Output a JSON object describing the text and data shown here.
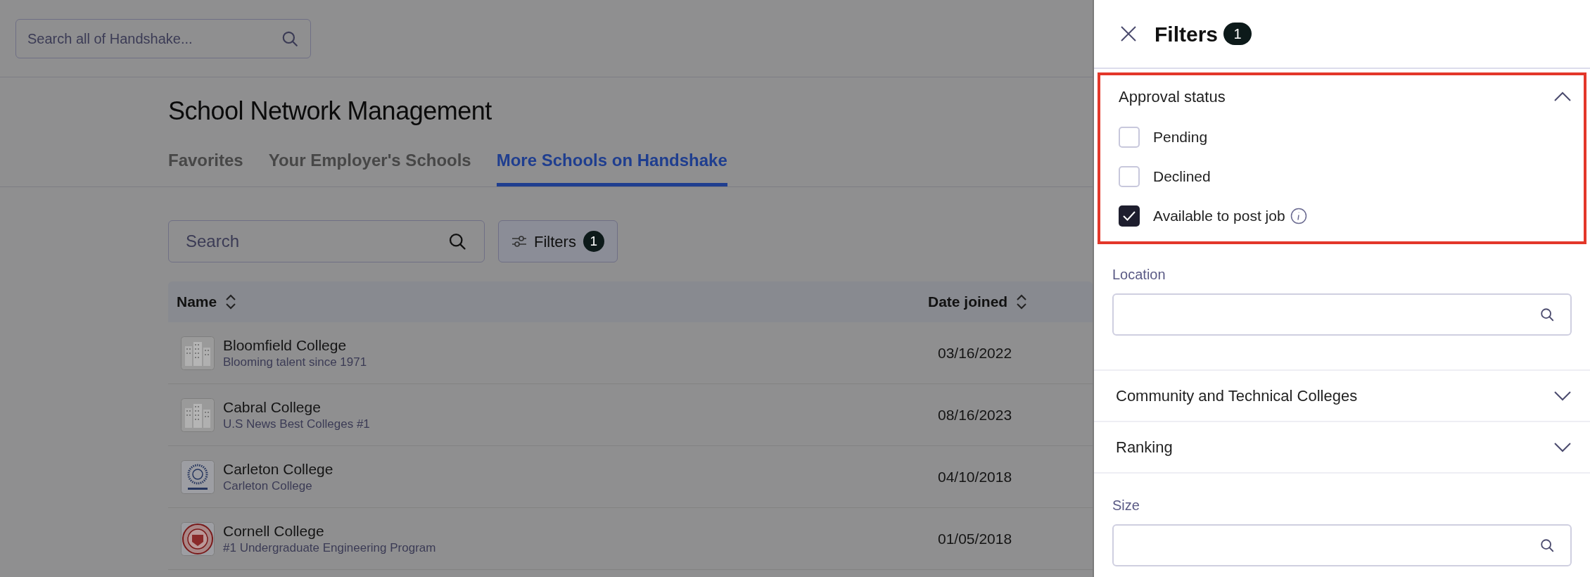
{
  "global_search": {
    "placeholder": "Search all of Handshake..."
  },
  "page": {
    "title": "School Network Management"
  },
  "tabs": [
    {
      "label": "Favorites",
      "selected": false
    },
    {
      "label": "Your Employer's Schools",
      "selected": false
    },
    {
      "label": "More Schools on Handshake",
      "selected": true
    }
  ],
  "search": {
    "placeholder": "Search"
  },
  "filters_button": {
    "label": "Filters",
    "count": "1"
  },
  "table": {
    "columns": [
      {
        "label": "Name"
      },
      {
        "label": "Date joined"
      }
    ],
    "rows": [
      {
        "name": "Bloomfield College",
        "tagline": "Blooming talent since 1971",
        "date_joined": "03/16/2022",
        "kind": "building"
      },
      {
        "name": "Cabral College",
        "tagline": "U.S News Best Colleges #1",
        "date_joined": "08/16/2023",
        "kind": "building"
      },
      {
        "name": "Carleton College",
        "tagline": "Carleton College",
        "date_joined": "04/10/2018",
        "kind": "blue-seal"
      },
      {
        "name": "Cornell College",
        "tagline": "#1 Undergraduate Engineering Program",
        "date_joined": "01/05/2018",
        "kind": "red-seal"
      }
    ]
  },
  "filters_panel": {
    "title": "Filters",
    "count": "1",
    "sections": [
      {
        "kind": "checklist",
        "title": "Approval status",
        "expanded": true,
        "highlighted": true,
        "options": [
          {
            "label": "Pending",
            "checked": false,
            "info": false
          },
          {
            "label": "Declined",
            "checked": false,
            "info": false
          },
          {
            "label": "Available to post job",
            "checked": true,
            "info": true
          }
        ]
      },
      {
        "kind": "field",
        "label": "Location"
      },
      {
        "kind": "accordion",
        "title": "Community and Technical Colleges",
        "expanded": false
      },
      {
        "kind": "accordion",
        "title": "Ranking",
        "expanded": false
      },
      {
        "kind": "field",
        "label": "Size"
      }
    ]
  }
}
